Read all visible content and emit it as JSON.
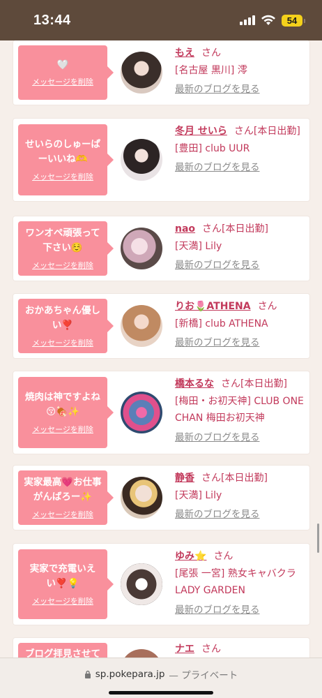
{
  "status_bar": {
    "time": "13:44",
    "battery": "54"
  },
  "colors": {
    "status_bg": "#5e4a3b",
    "bubble_pink": "#f9909c",
    "name_red": "#c2395b",
    "link_gray": "#8a8a8a",
    "battery_yellow": "#f4d11b"
  },
  "cards": [
    {
      "message": "🤍",
      "delete_label": "メッセージを削除",
      "name": "もえ",
      "suffix": "さん",
      "shop": "[名古屋 黒川] 澪",
      "blog_label": "最新のブログを見る"
    },
    {
      "message": "せいらのしゅーぱーいいね🫶",
      "delete_label": "メッセージを削除",
      "name": "冬月 せいら",
      "suffix": "さん[本日出勤]",
      "shop": "[豊田] club UUR",
      "blog_label": "最新のブログを見る"
    },
    {
      "message": "ワンオペ頑張って下さい☺️",
      "delete_label": "メッセージを削除",
      "name": "nao",
      "suffix": "さん[本日出勤]",
      "shop": "[天満] Lily",
      "blog_label": "最新のブログを見る"
    },
    {
      "message": "おかあちゃん優しい❣️",
      "delete_label": "メッセージを削除",
      "name": "りお🌷ATHENA",
      "suffix": "さん",
      "shop": "[新橋] club ATHENA",
      "blog_label": "最新のブログを見る"
    },
    {
      "message": "焼肉は神ですよね😚🍖✨",
      "delete_label": "メッセージを削除",
      "name": "橋本るな",
      "suffix": "さん[本日出勤]",
      "shop": "[梅田・お初天神] CLUB ONE CHAN 梅田お初天神",
      "blog_label": "最新のブログを見る"
    },
    {
      "message": "実家最高💗お仕事がんばろー✨",
      "delete_label": "メッセージを削除",
      "name": "静香",
      "suffix": "さん[本日出勤]",
      "shop": "[天満] Lily",
      "blog_label": "最新のブログを見る"
    },
    {
      "message": "実家で充電いえい❣️💡",
      "delete_label": "メッセージを削除",
      "name": "ゆみ⭐",
      "suffix": "さん",
      "shop": "[尾張 一宮] 熟女キャバクラ LADY GARDEN",
      "blog_label": "最新のブログを見る"
    },
    {
      "message": "ブログ拝見させて",
      "delete_label": "",
      "name": "ナエ",
      "suffix": "さん",
      "shop": "",
      "blog_label": ""
    }
  ],
  "url_bar": {
    "domain": "sp.pokepara.jp",
    "suffix": "— プライベート"
  }
}
